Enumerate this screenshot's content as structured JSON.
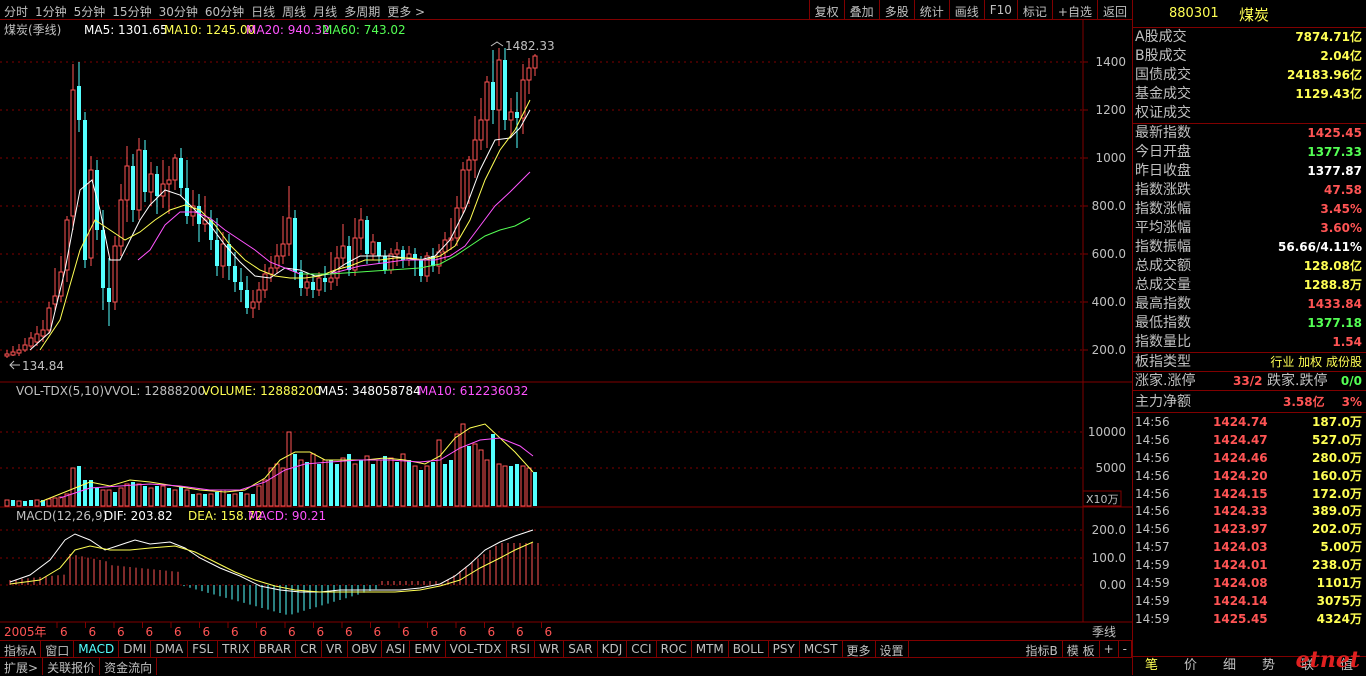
{
  "toolbar": {
    "left": [
      "分时",
      "1分钟",
      "5分钟",
      "15分钟",
      "30分钟",
      "60分钟",
      "日线",
      "周线",
      "月线",
      "多周期",
      "更多 >"
    ],
    "right": [
      "复权",
      "叠加",
      "多股",
      "统计",
      "画线",
      "F10",
      "标记",
      "+自选",
      "返回"
    ]
  },
  "main_chart": {
    "title": "煤炭(季线)",
    "ma5": "MA5: 1301.65",
    "ma10": "MA10: 1245.00",
    "ma20": "MA20: 940.32",
    "ma60": "MA60: 743.02",
    "high_label": "1482.33",
    "low_label": "134.84",
    "y_ticks": [
      "1400",
      "1200",
      "1000",
      "800.0",
      "600.0",
      "400.0",
      "200.0"
    ]
  },
  "vol_chart": {
    "name": "VOL-TDX(5,10)",
    "vvol": "VVOL: 12888200",
    "volume": "VOLUME: 12888200",
    "ma5": "MA5: 348058784",
    "ma10": "MA10: 612236032",
    "y_ticks": [
      "10000",
      "5000"
    ],
    "unit": "X10万"
  },
  "macd_chart": {
    "name": "MACD(12,26,9)",
    "dif": "DIF: 203.82",
    "dea": "DEA: 158.72",
    "macd": "MACD: 90.21",
    "y_ticks": [
      "200.0",
      "100.0",
      "0.00"
    ]
  },
  "time_axis": {
    "start": "2005年",
    "period": "季线",
    "marks": [
      "6",
      "6",
      "6",
      "6",
      "6",
      "6",
      "6",
      "6",
      "6",
      "6",
      "6",
      "6",
      "6",
      "6",
      "6",
      "6",
      "6",
      "6"
    ]
  },
  "tabs_row1": [
    "指标A",
    "窗口",
    "MACD",
    "DMI",
    "DMA",
    "FSL",
    "TRIX",
    "BRAR",
    "CR",
    "VR",
    "OBV",
    "ASI",
    "EMV",
    "VOL-TDX",
    "RSI",
    "WR",
    "SAR",
    "KDJ",
    "CCI",
    "ROC",
    "MTM",
    "BOLL",
    "PSY",
    "MCST",
    "更多",
    "设置"
  ],
  "tabs_row1_right": [
    "指标B",
    "模 板",
    "+",
    "-"
  ],
  "tabs_row2": [
    "扩展>",
    "关联报价",
    "资金流向"
  ],
  "right_panel": {
    "code": "880301",
    "name": "煤炭",
    "stats": [
      {
        "label": "A股成交",
        "value": "7874.71亿",
        "color": "#ffff54"
      },
      {
        "label": "B股成交",
        "value": "2.04亿",
        "color": "#ffff54"
      },
      {
        "label": "国债成交",
        "value": "24183.96亿",
        "color": "#ffff54"
      },
      {
        "label": "基金成交",
        "value": "1129.43亿",
        "color": "#ffff54"
      },
      {
        "label": "权证成交",
        "value": "",
        "color": "#ffff54"
      }
    ],
    "index": [
      {
        "label": "最新指数",
        "value": "1425.45",
        "color": "#ff5454"
      },
      {
        "label": "今日开盘",
        "value": "1377.33",
        "color": "#54ff54"
      },
      {
        "label": "昨日收盘",
        "value": "1377.87",
        "color": "#ffffff"
      },
      {
        "label": "指数涨跌",
        "value": "47.58",
        "color": "#ff5454"
      },
      {
        "label": "指数涨幅",
        "value": "3.45%",
        "color": "#ff5454"
      },
      {
        "label": "平均涨幅",
        "value": "3.60%",
        "color": "#ff5454"
      },
      {
        "label": "指数振幅",
        "value": "56.66/4.11%",
        "color": "#ffffff"
      },
      {
        "label": "总成交额",
        "value": "128.08亿",
        "color": "#ffff54"
      },
      {
        "label": "总成交量",
        "value": "1288.8万",
        "color": "#ffff54"
      },
      {
        "label": "最高指数",
        "value": "1433.84",
        "color": "#ff5454"
      },
      {
        "label": "最低指数",
        "value": "1377.18",
        "color": "#54ff54"
      },
      {
        "label": "指数量比",
        "value": "1.54",
        "color": "#ff5454"
      }
    ],
    "sector_type_label": "板指类型",
    "sector_type_value": "行业 加权 成份股",
    "rise_label": "涨家.涨停",
    "rise_value": "33/2",
    "fall_label": "跌家.跌停",
    "fall_value": "0/0",
    "main_label": "主力净额",
    "main_value": "3.58亿",
    "main_pct": "3%",
    "ticks": [
      {
        "time": "14:56",
        "price": "1424.74",
        "vol": "187.0万"
      },
      {
        "time": "14:56",
        "price": "1424.47",
        "vol": "527.0万"
      },
      {
        "time": "14:56",
        "price": "1424.46",
        "vol": "280.0万"
      },
      {
        "time": "14:56",
        "price": "1424.20",
        "vol": "160.0万"
      },
      {
        "time": "14:56",
        "price": "1424.15",
        "vol": "172.0万"
      },
      {
        "time": "14:56",
        "price": "1424.33",
        "vol": "389.0万"
      },
      {
        "time": "14:56",
        "price": "1423.97",
        "vol": "202.0万"
      },
      {
        "time": "14:57",
        "price": "1424.03",
        "vol": "5.00万"
      },
      {
        "time": "14:59",
        "price": "1424.01",
        "vol": "238.0万"
      },
      {
        "time": "14:59",
        "price": "1424.08",
        "vol": "1101万"
      },
      {
        "time": "14:59",
        "price": "1424.14",
        "vol": "3075万"
      },
      {
        "time": "14:59",
        "price": "1425.45",
        "vol": "4324万"
      }
    ],
    "bottom_tabs": [
      "笔",
      "价",
      "细",
      "势",
      "联",
      "值"
    ],
    "logo": "etnet"
  },
  "colors": {
    "up": "#ff5454",
    "down": "#54ffff",
    "ma5": "#ffffff",
    "ma10": "#ffff54",
    "ma20": "#ff54ff",
    "ma60": "#54ff54",
    "grid": "#800000"
  }
}
